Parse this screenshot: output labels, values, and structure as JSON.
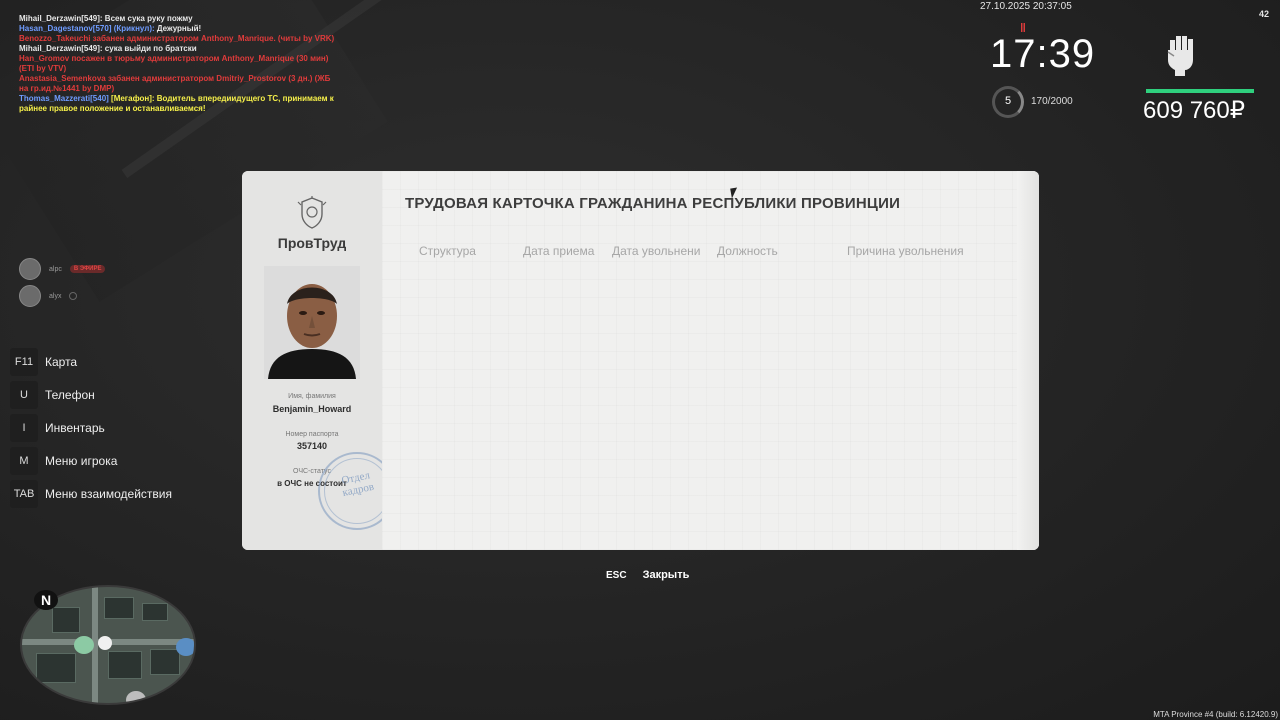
{
  "chat": [
    [
      {
        "t": "Mihail_Derzawin[549]: Всем сука руку пожму",
        "c": "white"
      }
    ],
    [
      {
        "t": "Hasan_Dagestanov[570] (Крикнул): ",
        "c": "blue"
      },
      {
        "t": "Дежурный!",
        "c": "white"
      }
    ],
    [
      {
        "t": "Benozzo_Takeuchi забанен администратором Anthony_Manrique. (читы by VRK)",
        "c": "red"
      }
    ],
    [
      {
        "t": "Mihail_Derzawin[549]: сука выйди по братски",
        "c": "white"
      }
    ],
    [
      {
        "t": "Han_Gromov посажен в тюрьму администратором Anthony_Manrique (30 мин) (ETI by VTV)",
        "c": "red"
      }
    ],
    [
      {
        "t": "Anastasia_Semenkova забанен администратором Dmitriy_Prostorov (3 дн.) (ЖБ на гр.ид.№1441 by DMP)",
        "c": "red"
      }
    ],
    [
      {
        "t": "Thomas_Mazzerati[540] ",
        "c": "blue"
      },
      {
        "t": "[Мегафон]: Водитель впередиидущего ТС, принимаем к райнее правое положение и останавливаемся!",
        "c": "yellow"
      }
    ]
  ],
  "hud": {
    "datetime": "27.10.2025 20:37:05",
    "fps": "42",
    "clock": "17:39",
    "level": "5",
    "xp": "170/2000",
    "money": "609 760₽",
    "health_fraction": 1.0,
    "icons": {
      "food": "fork-knife-icon",
      "fist": "raised-fist-icon"
    }
  },
  "voice": [
    {
      "name": "alpc",
      "badge": "В ЭФИРЕ"
    },
    {
      "name": "alyx",
      "badge": ""
    }
  ],
  "hotkeys": [
    {
      "key": "F11",
      "label": "Карта"
    },
    {
      "key": "U",
      "label": "Телефон"
    },
    {
      "key": "I",
      "label": "Инвентарь"
    },
    {
      "key": "M",
      "label": "Меню игрока"
    },
    {
      "key": "TAB",
      "label": "Меню взаимодействия"
    }
  ],
  "card": {
    "org_name": "ПровТруд",
    "title": "ТРУДОВАЯ КАРТОЧКА ГРАЖДАНИНА РЕСПУБЛИКИ ПРОВИНЦИИ",
    "columns": [
      "Структура",
      "Дата приема",
      "Дата увольнени",
      "Должность",
      "Причина увольнения"
    ],
    "name_label": "Имя, фамилия",
    "name_value": "Benjamin_Howard",
    "passport_label": "Номер паспорта",
    "passport_value": "357140",
    "status_label": "ОЧС-статус",
    "status_value": "в ОЧС не состоит",
    "stamp_line1": "Отдел",
    "stamp_line2": "кадров"
  },
  "close_hint": {
    "key": "ESC",
    "label": "Закрыть"
  },
  "minimap": {
    "north": "N"
  },
  "build_info": "MTA Province #4 (build: 6.12420.9)"
}
